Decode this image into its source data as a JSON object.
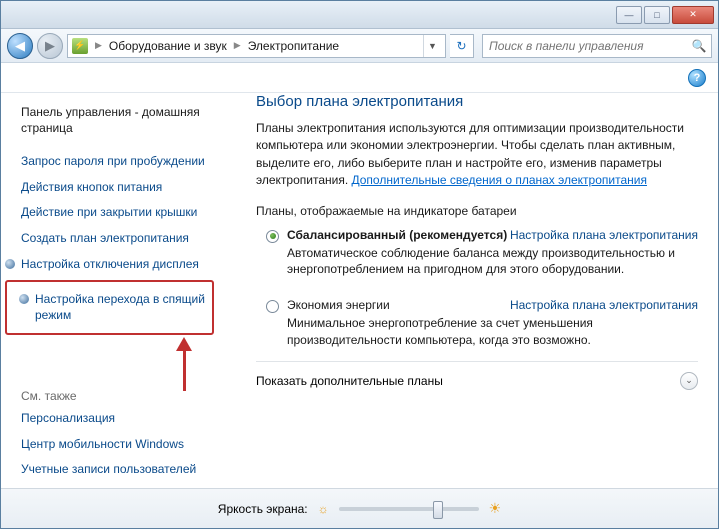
{
  "titlebar": {
    "minimize": "—",
    "maximize": "□",
    "close": "✕"
  },
  "nav": {
    "back": "◀",
    "forward": "▶",
    "crumb1": "Оборудование и звук",
    "crumb2": "Электропитание",
    "sep": "▶",
    "dropdown": "▼",
    "refresh": "↻"
  },
  "search": {
    "placeholder": "Поиск в панели управления",
    "icon": "🔍"
  },
  "help": {
    "icon": "?"
  },
  "sidebar": {
    "home": "Панель управления - домашняя страница",
    "links": [
      "Запрос пароля при пробуждении",
      "Действия кнопок питания",
      "Действие при закрытии крышки",
      "Создать план электропитания",
      "Настройка отключения дисплея",
      "Настройка перехода в спящий режим"
    ],
    "also_heading": "См. также",
    "also": [
      "Персонализация",
      "Центр мобильности Windows",
      "Учетные записи пользователей"
    ]
  },
  "main": {
    "heading": "Выбор плана электропитания",
    "desc_pre": "Планы электропитания используются для оптимизации производительности компьютера или экономии электроэнергии. Чтобы сделать план активным, выделите его, либо выберите план и настройте его, изменив параметры электропитания. ",
    "desc_link": "Дополнительные сведения о планах электропитания",
    "section": "Планы, отображаемые на индикаторе батареи",
    "plan1": {
      "title": "Сбалансированный (рекомендуется)",
      "link": "Настройка плана электропитания",
      "desc": "Автоматическое соблюдение баланса между производительностью и энергопотреблением на пригодном для этого оборудовании."
    },
    "plan2": {
      "title": "Экономия энергии",
      "link": "Настройка плана электропитания",
      "desc": "Минимальное энергопотребление за счет уменьшения производительности компьютера, когда это возможно."
    },
    "expand": "Показать дополнительные планы",
    "expand_icon": "⌄"
  },
  "footer": {
    "label": "Яркость экрана:",
    "sun_small": "☼",
    "sun_big": "☀"
  }
}
